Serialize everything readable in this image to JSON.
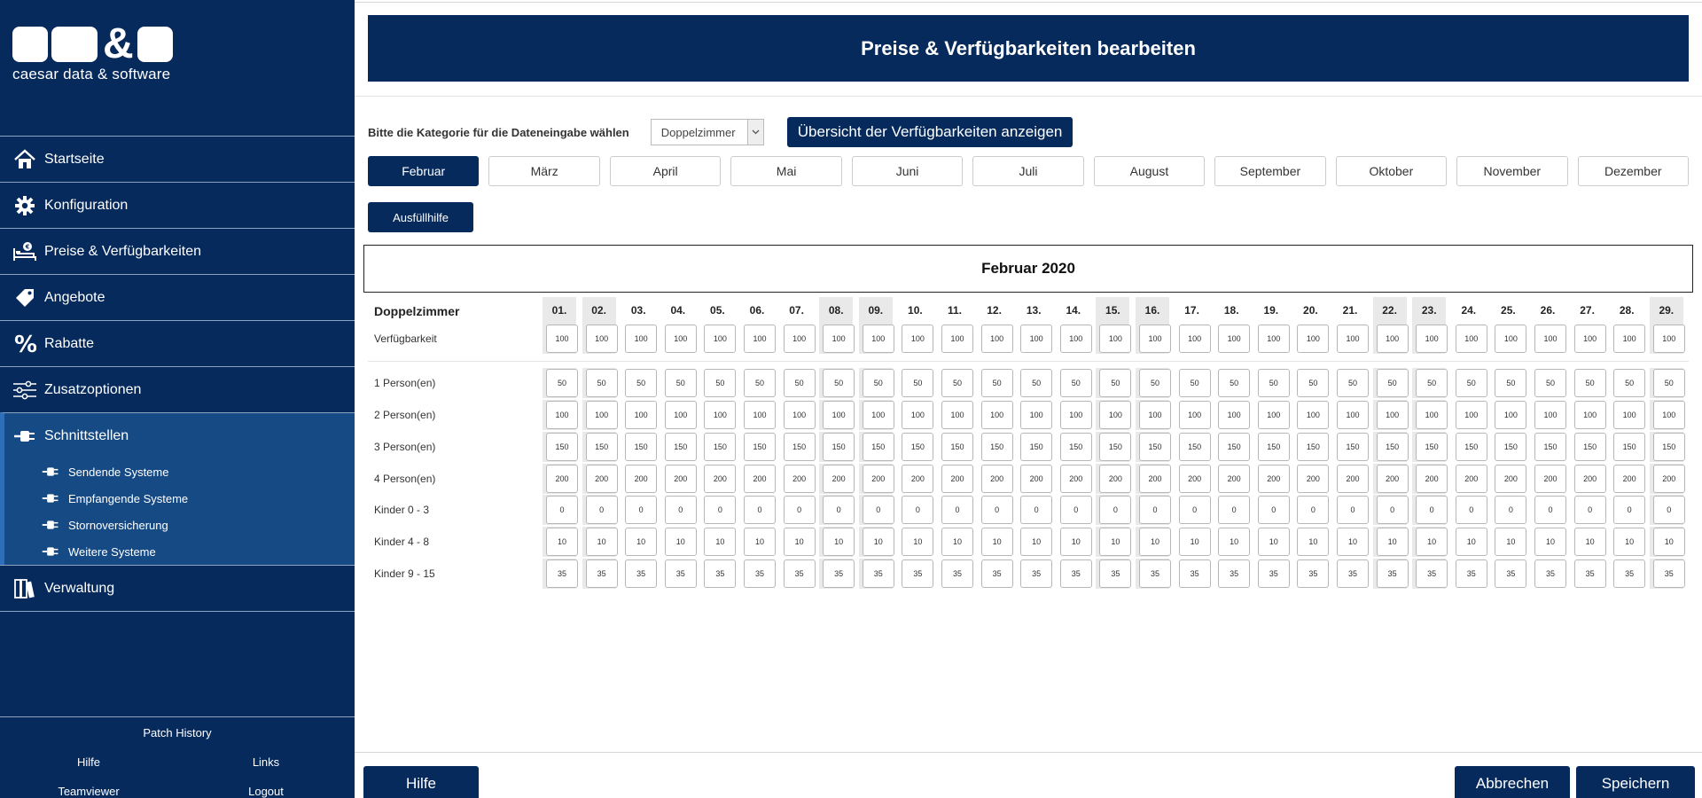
{
  "brand": {
    "name": "caesar data & software",
    "amp": "&"
  },
  "nav": [
    {
      "label": "Startseite",
      "icon": "home-icon"
    },
    {
      "label": "Konfiguration",
      "icon": "gear-icon"
    },
    {
      "label": "Preise & Verfügbarkeiten",
      "icon": "bed-price-icon"
    },
    {
      "label": "Angebote",
      "icon": "tag-icon"
    },
    {
      "label": "Rabatte",
      "icon": "percent-icon"
    },
    {
      "label": "Zusatzoptionen",
      "icon": "sliders-icon"
    },
    {
      "label": "Schnittstellen",
      "icon": "plug-icon"
    }
  ],
  "subnav": [
    {
      "label": "Sendende Systeme",
      "icon": "plug-icon"
    },
    {
      "label": "Empfangende Systeme",
      "icon": "plug-icon"
    },
    {
      "label": "Stornoversicherung",
      "icon": "plug-icon"
    },
    {
      "label": "Weitere Systeme",
      "icon": "plug-icon"
    }
  ],
  "nav_last": {
    "label": "Verwaltung",
    "icon": "binders-icon"
  },
  "sidebar_bottom": {
    "patch": "Patch History",
    "help": "Hilfe",
    "links": "Links",
    "teamviewer": "Teamviewer",
    "logout": "Logout"
  },
  "header": {
    "title": "Preise & Verfügbarkeiten bearbeiten"
  },
  "category": {
    "label": "Bitte die Kategorie für die Dateneingabe wählen",
    "selected": "Doppelzimmer",
    "overview_button": "Übersicht der Verfügbarkeiten anzeigen"
  },
  "months": [
    "Februar",
    "März",
    "April",
    "Mai",
    "Juni",
    "Juli",
    "August",
    "September",
    "Oktober",
    "November",
    "Dezember"
  ],
  "active_month": "Februar",
  "fill_button": "Ausfüllhilfe",
  "month_title": "Februar 2020",
  "table": {
    "room": "Doppelzimmer",
    "days": [
      "01.",
      "02.",
      "03.",
      "04.",
      "05.",
      "06.",
      "07.",
      "08.",
      "09.",
      "10.",
      "11.",
      "12.",
      "13.",
      "14.",
      "15.",
      "16.",
      "17.",
      "18.",
      "19.",
      "20.",
      "21.",
      "22.",
      "23.",
      "24.",
      "25.",
      "26.",
      "27.",
      "28.",
      "29."
    ],
    "weekend_days": [
      "01.",
      "02.",
      "08.",
      "09.",
      "15.",
      "16.",
      "22.",
      "23.",
      "29."
    ],
    "availability": {
      "label": "Verfügbarkeit",
      "value": "100"
    },
    "price_rows": [
      {
        "label": "1 Person(en)",
        "value": "50"
      },
      {
        "label": "2 Person(en)",
        "value": "100"
      },
      {
        "label": "3 Person(en)",
        "value": "150"
      },
      {
        "label": "4 Person(en)",
        "value": "200"
      },
      {
        "label": "Kinder 0 - 3",
        "value": "0"
      },
      {
        "label": "Kinder 4 - 8",
        "value": "10"
      },
      {
        "label": "Kinder 9 - 15",
        "value": "35"
      }
    ]
  },
  "footer": {
    "help": "Hilfe",
    "cancel": "Abbrechen",
    "save": "Speichern"
  },
  "colors": {
    "primary": "#062a5c",
    "active_sub": "#164a85",
    "weekend": "#e9e9e9"
  }
}
